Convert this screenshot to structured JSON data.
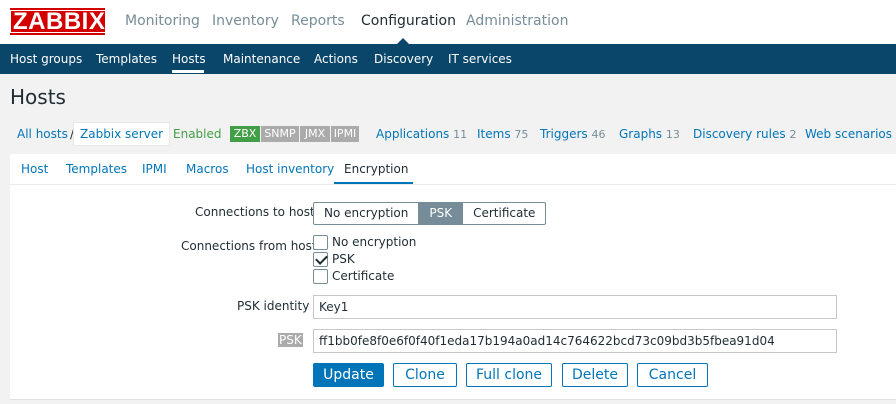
{
  "brand": {
    "logo_text": "ZABBIX",
    "logo_color": "#d40000"
  },
  "main_menu": {
    "items": [
      "Monitoring",
      "Inventory",
      "Reports",
      "Configuration",
      "Administration"
    ],
    "active": "Configuration"
  },
  "sub_menu": {
    "items": [
      "Host groups",
      "Templates",
      "Hosts",
      "Maintenance",
      "Actions",
      "Discovery",
      "IT services"
    ],
    "active": "Hosts"
  },
  "page": {
    "title": "Hosts"
  },
  "host_nav": {
    "all_hosts": "All hosts",
    "separator": "/",
    "host_name": "Zabbix server",
    "status": "Enabled",
    "availability": [
      "ZBX",
      "SNMP",
      "JMX",
      "IPMI"
    ],
    "links": [
      {
        "label": "Applications",
        "count": "11"
      },
      {
        "label": "Items",
        "count": "75"
      },
      {
        "label": "Triggers",
        "count": "46"
      },
      {
        "label": "Graphs",
        "count": "13"
      },
      {
        "label": "Discovery rules",
        "count": "2"
      },
      {
        "label": "Web scenarios",
        "count": ""
      }
    ]
  },
  "tabs": {
    "items": [
      "Host",
      "Templates",
      "IPMI",
      "Macros",
      "Host inventory",
      "Encryption"
    ],
    "active": "Encryption"
  },
  "form": {
    "connections_to_host": {
      "label": "Connections to host",
      "options": [
        "No encryption",
        "PSK",
        "Certificate"
      ],
      "selected": "PSK"
    },
    "connections_from_host": {
      "label": "Connections from host",
      "options": [
        {
          "label": "No encryption",
          "checked": false
        },
        {
          "label": "PSK",
          "checked": true
        },
        {
          "label": "Certificate",
          "checked": false
        }
      ]
    },
    "psk_identity": {
      "label": "PSK identity",
      "value": "Key1"
    },
    "psk": {
      "label": "PSK",
      "value": "ff1bb0fe8f0e6f0f40f1eda17b194a0ad14c764622bcd73c09bd3b5fbea91d04"
    }
  },
  "buttons": {
    "update": "Update",
    "clone": "Clone",
    "full_clone": "Full clone",
    "delete": "Delete",
    "cancel": "Cancel"
  },
  "colors": {
    "accent": "#0275b8",
    "header_bg": "#0a466a",
    "enabled": "#429e47",
    "muted": "#768d99"
  }
}
